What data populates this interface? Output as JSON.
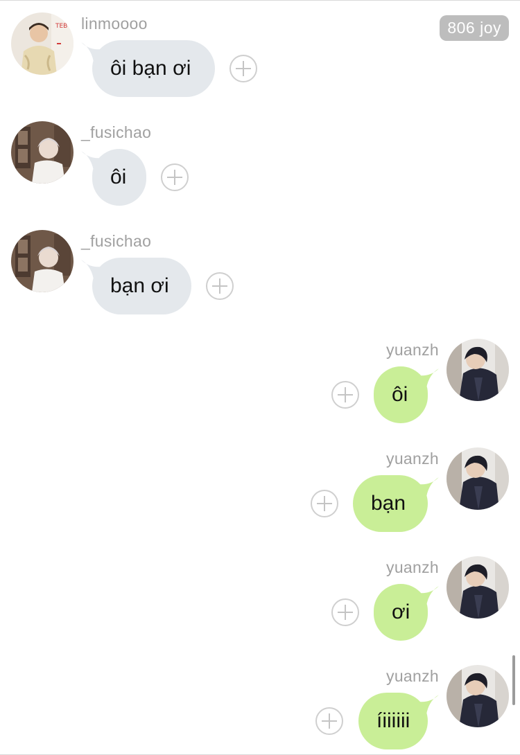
{
  "header": {
    "joy_badge": "806 joy"
  },
  "messages": [
    {
      "sender": "linmoooo",
      "text": "ôi bạn ơi",
      "side": "incoming",
      "avatar": "avatar-linmoooo"
    },
    {
      "sender": "_fusichao",
      "text": "ôi",
      "side": "incoming",
      "avatar": "avatar-fusichao"
    },
    {
      "sender": "_fusichao",
      "text": "bạn ơi",
      "side": "incoming",
      "avatar": "avatar-fusichao"
    },
    {
      "sender": "yuanzh",
      "text": "ôi",
      "side": "outgoing",
      "avatar": "avatar-yuanzh"
    },
    {
      "sender": "yuanzh",
      "text": "bạn",
      "side": "outgoing",
      "avatar": "avatar-yuanzh"
    },
    {
      "sender": "yuanzh",
      "text": "ơi",
      "side": "outgoing",
      "avatar": "avatar-yuanzh"
    },
    {
      "sender": "yuanzh",
      "text": "íiiiiii",
      "side": "outgoing",
      "avatar": "avatar-yuanzh"
    }
  ],
  "colors": {
    "incoming_bubble": "#e4e8ec",
    "outgoing_bubble": "#c9ee97",
    "username": "#a0a0a0",
    "badge_bg": "#bdbdbd"
  },
  "icons": {
    "reaction_button": "plus-circle-icon"
  }
}
